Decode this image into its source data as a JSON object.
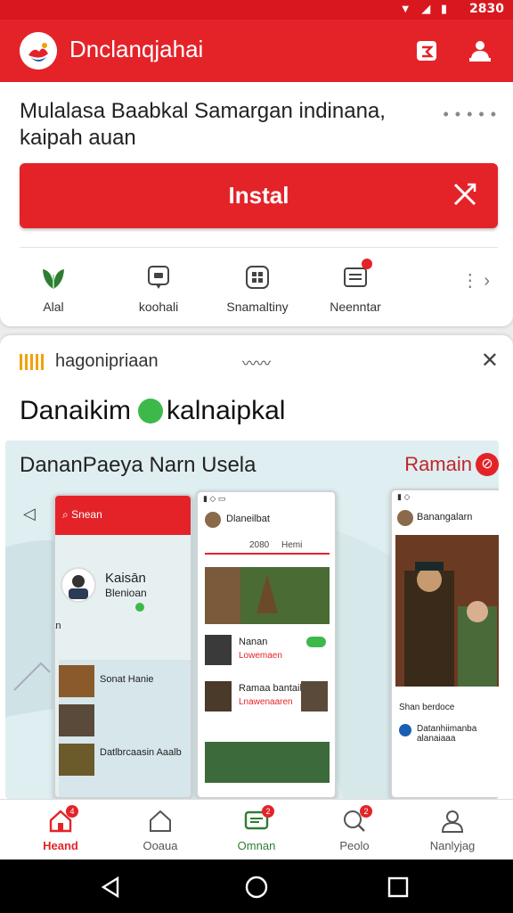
{
  "status_bar": {
    "time": "2830"
  },
  "app_bar": {
    "title": "Dnclanqjahai"
  },
  "app_card": {
    "description": "Mulalasa Baabkal Samargan indinana, kaipah auan",
    "install_label": "Instal",
    "quick_actions": [
      {
        "label": "Alal",
        "icon": "leaf-icon"
      },
      {
        "label": "koohali",
        "icon": "chat-icon"
      },
      {
        "label": "Snamaltiny",
        "icon": "grid-icon"
      },
      {
        "label": "Neenntar",
        "icon": "inbox-icon"
      }
    ]
  },
  "promo_card": {
    "brand": "hagonipriaan",
    "headline_left": "Danaikim",
    "headline_right": "kalnaipkal",
    "banner_title": "DananPaeya Narn Usela",
    "banner_right": "Ramain",
    "phone1": {
      "search": "Snean",
      "profile_name": "Kaisān",
      "profile_sub": "Blenioan",
      "map_label": "Naaoan",
      "list": [
        "Sonat Hanie",
        "",
        "Datlbrcaasin Aaalb"
      ]
    },
    "phone2": {
      "header": "Dlaneilbat",
      "tabs": [
        "2080",
        "Hemi"
      ],
      "rows": [
        {
          "title": "Nanan",
          "sub": "Lowemaen"
        },
        {
          "title": "Ramaa bantail",
          "sub": "Lnawenaaren"
        }
      ]
    },
    "phone3": {
      "header": "Banangalarn",
      "sub": "Shan berdoce",
      "row": "Datanhiimanba alanaiaaa"
    }
  },
  "bottom_nav": [
    {
      "label": "Heand",
      "icon": "home-icon",
      "badge": "4",
      "active": true
    },
    {
      "label": "Ooaua",
      "icon": "house-outline-icon",
      "badge": "",
      "active": false
    },
    {
      "label": "Omnan",
      "icon": "message-icon",
      "badge": "2",
      "active": false
    },
    {
      "label": "Peolo",
      "icon": "search-chat-icon",
      "badge": "2",
      "active": false
    },
    {
      "label": "Nanlyjag",
      "icon": "user-icon",
      "badge": "",
      "active": false
    }
  ],
  "colors": {
    "accent": "#e42329",
    "green": "#3db94a",
    "text": "#222222"
  }
}
